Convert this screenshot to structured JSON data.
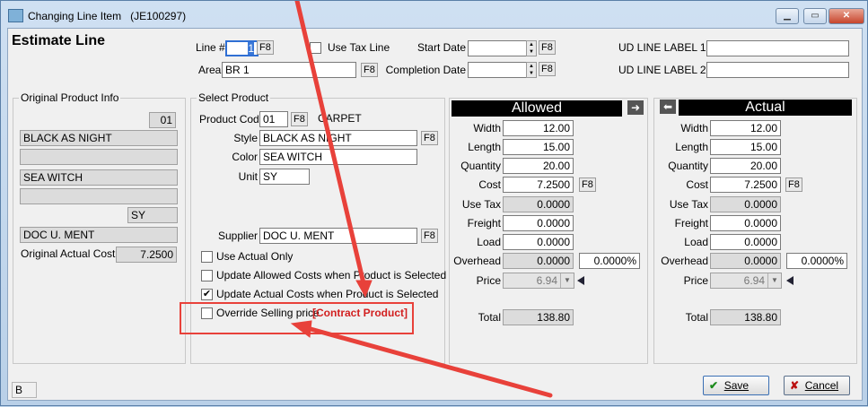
{
  "window": {
    "title": "Changing Line Item",
    "job": "(JE100297)",
    "heading": "Estimate Line"
  },
  "top": {
    "line_label": "Line #",
    "line_value": "1",
    "f8": "F8",
    "use_tax_label": "Use Tax Line",
    "start_date_label": "Start Date",
    "start_date_value": "",
    "completion_date_label": "Completion Date",
    "completion_date_value": "",
    "area_label": "Area",
    "area_value": "BR 1",
    "ud1_label": "UD LINE LABEL 1",
    "ud1_value": "",
    "ud2_label": "UD LINE LABEL 2",
    "ud2_value": ""
  },
  "original": {
    "title": "Original Product Info",
    "code": "01",
    "style": "BLACK AS NIGHT",
    "blank1": "",
    "color": "SEA WITCH",
    "blank2": "",
    "unit": "SY",
    "supplier": "DOC U. MENT",
    "cost_label": "Original Actual Cost:",
    "cost_value": "7.2500"
  },
  "select": {
    "title": "Select Product",
    "product_code_label": "Product Code",
    "product_code_value": "01",
    "product_type": "CARPET",
    "style_label": "Style",
    "style_value": "BLACK AS NIGHT",
    "color_label": "Color",
    "color_value": "SEA WITCH",
    "unit_label": "Unit",
    "unit_value": "SY",
    "supplier_label": "Supplier",
    "supplier_value": "DOC U. MENT",
    "use_actual_only": "Use Actual Only",
    "update_allowed": "Update Allowed Costs when Product is Selected",
    "update_actual": "Update Actual Costs when Product is Selected",
    "override": "Override Selling price",
    "contract": "[Contract Product]"
  },
  "fields": {
    "width": "Width",
    "length": "Length",
    "quantity": "Quantity",
    "cost": "Cost",
    "use_tax": "Use Tax",
    "freight": "Freight",
    "load": "Load",
    "overhead": "Overhead",
    "price": "Price",
    "total": "Total"
  },
  "allowed": {
    "header": "Allowed",
    "width": "12.00",
    "length": "15.00",
    "quantity": "20.00",
    "cost": "7.2500",
    "use_tax": "0.0000",
    "freight": "0.0000",
    "load": "0.0000",
    "overhead": "0.0000",
    "overhead_pct": "0.0000%",
    "price": "6.94",
    "total": "138.80"
  },
  "actual": {
    "header": "Actual",
    "width": "12.00",
    "length": "15.00",
    "quantity": "20.00",
    "cost": "7.2500",
    "use_tax": "0.0000",
    "freight": "0.0000",
    "load": "0.0000",
    "overhead": "0.0000",
    "overhead_pct": "0.0000%",
    "price": "6.94",
    "total": "138.80"
  },
  "footer": {
    "status": "B",
    "save": "Save",
    "cancel": "Cancel"
  },
  "colors": {
    "annotation_red": "#e8413a",
    "contract_red": "#d21f1f"
  }
}
